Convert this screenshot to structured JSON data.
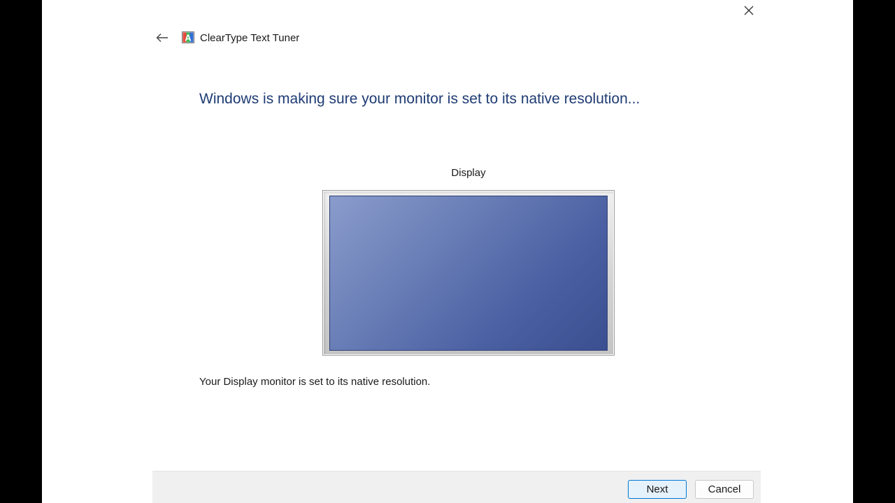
{
  "window": {
    "title": "ClearType Text Tuner",
    "close_icon": "close-icon",
    "back_icon": "back-arrow-icon",
    "app_icon": "cleartype-app-icon",
    "app_icon_letter": "A"
  },
  "content": {
    "heading": "Windows is making sure your monitor is set to its native resolution...",
    "display_label": "Display",
    "status_text": "Your Display monitor is set to its native resolution."
  },
  "footer": {
    "next_label": "Next",
    "cancel_label": "Cancel"
  },
  "colors": {
    "heading": "#1e3b73",
    "screen": "#4a60a2",
    "primary_border": "#0078d4"
  }
}
